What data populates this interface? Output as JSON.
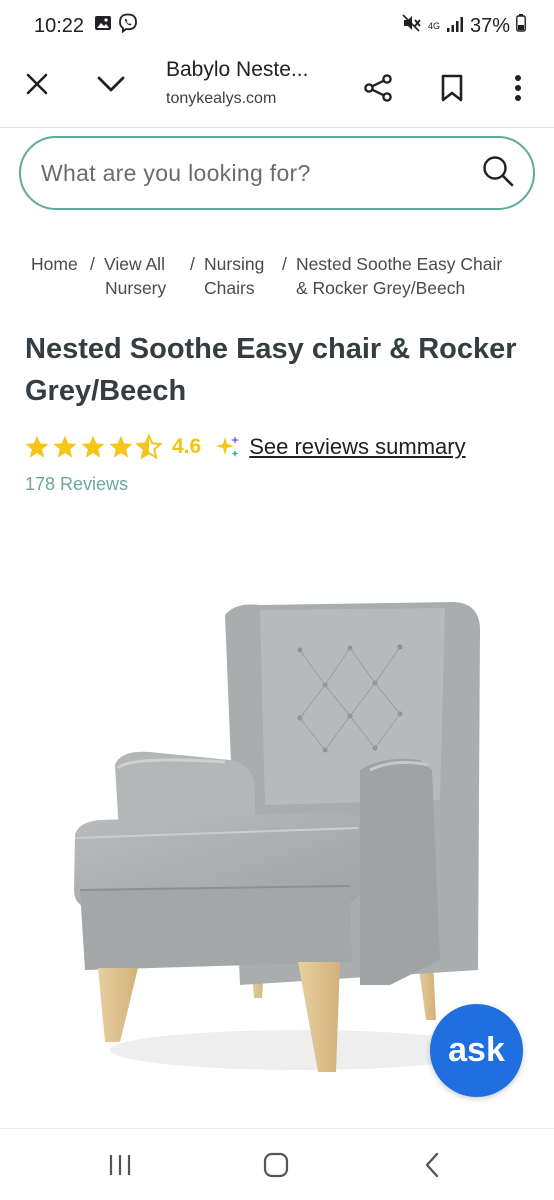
{
  "status_bar": {
    "time": "10:22",
    "network": "4G",
    "battery": "37%"
  },
  "tab_bar": {
    "title": "Babylo Neste...",
    "url": "tonykealys.com"
  },
  "search": {
    "placeholder": "What are you looking for?"
  },
  "breadcrumb": {
    "home": "Home",
    "sep": "/",
    "view_all_line1": "View All",
    "view_all_line2": "Nursery",
    "nursing_line1": "Nursing",
    "nursing_line2": "Chairs",
    "current_line1": "Nested Soothe Easy Chair",
    "current_line2": "& Rocker Grey/Beech"
  },
  "product": {
    "title_line1": "Nested Soothe Easy chair & Rocker",
    "title_line2": "Grey/Beech",
    "rating": "4.6",
    "rating_value": 4.6,
    "reviews_link": "See reviews summary",
    "review_count": "178 Reviews"
  },
  "ask_button": {
    "label": "ask"
  },
  "colors": {
    "accent": "#5ea99c",
    "star": "#f5c518",
    "ask": "#1f6fe0",
    "title": "#333d42"
  }
}
